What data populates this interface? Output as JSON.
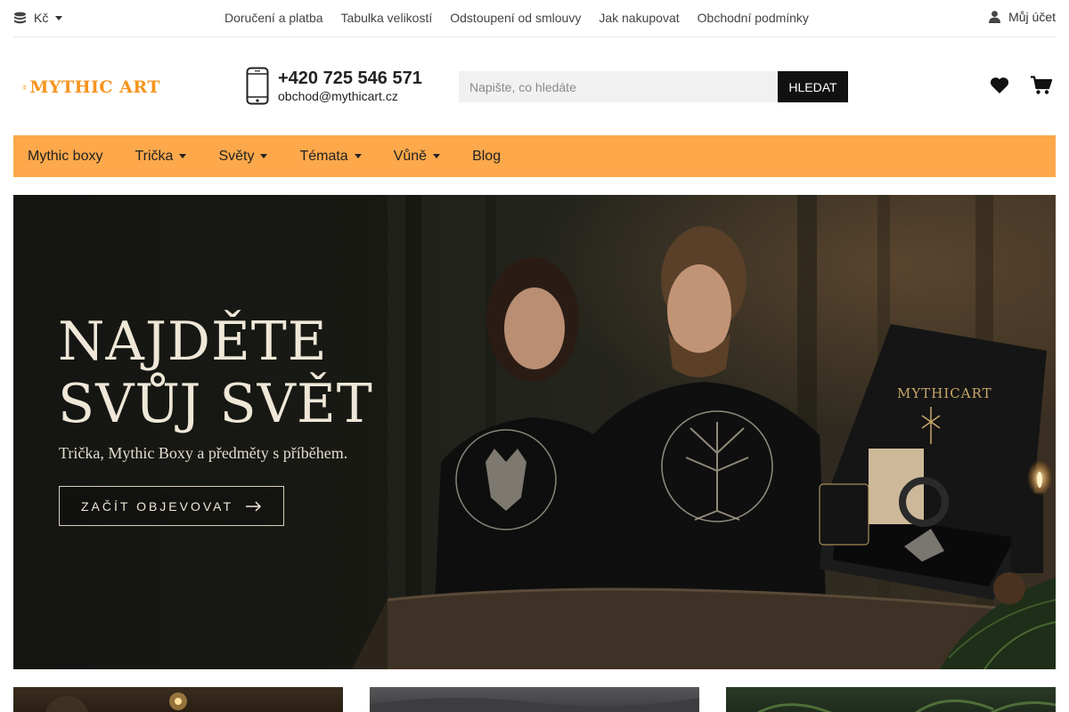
{
  "topbar": {
    "currency": "Kč",
    "currency_icon": "coins-icon",
    "links": [
      "Doručení a platba",
      "Tabulka velikostí",
      "Odstoupení od smlouvy",
      "Jak nakupovat",
      "Obchodní podmínky"
    ],
    "account_label": "Můj účet",
    "account_icon": "user-icon"
  },
  "header": {
    "logo_text": "MYTHIC ART",
    "logo_color": "#f7941d",
    "phone": "+420 725 546 571",
    "email": "obchod@mythicart.cz",
    "search_placeholder": "Napište, co hledáte",
    "search_value": "",
    "search_button": "HLEDAT",
    "wishlist_icon": "heart-icon",
    "cart_icon": "cart-icon"
  },
  "nav": {
    "background": "#fca84b",
    "items": [
      {
        "label": "Mythic boxy",
        "dropdown": false
      },
      {
        "label": "Trička",
        "dropdown": true
      },
      {
        "label": "Světy",
        "dropdown": true
      },
      {
        "label": "Témata",
        "dropdown": true
      },
      {
        "label": "Vůně",
        "dropdown": true
      },
      {
        "label": "Blog",
        "dropdown": false
      }
    ]
  },
  "hero": {
    "title": "NAJDĚTE\nSVŮJ SVĚT",
    "subtitle": "Trička, Mythic Boxy a předměty s příběhem.",
    "cta_label": "ZAČÍT OBJEVOVAT",
    "box_brand": "MYTHICART"
  }
}
